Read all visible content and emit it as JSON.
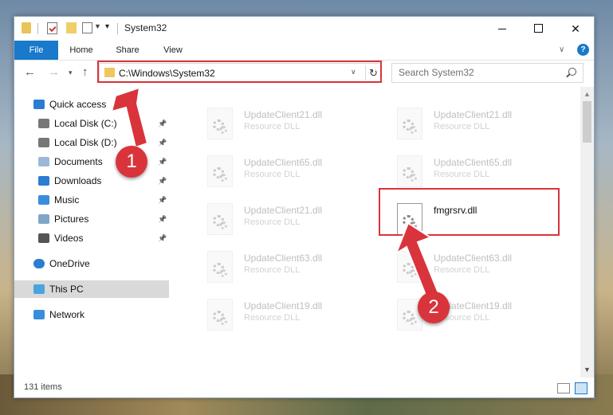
{
  "window": {
    "title": "System32",
    "quick_access_toolbar": [
      "folder-icon",
      "properties-icon",
      "new-folder-icon",
      "view-icon"
    ],
    "buttons": {
      "minimize": "—",
      "maximize": "☐",
      "close": "✕"
    }
  },
  "ribbon": {
    "tabs": [
      {
        "label": "File",
        "active": true
      },
      {
        "label": "Home"
      },
      {
        "label": "Share"
      },
      {
        "label": "View"
      }
    ],
    "help": "?"
  },
  "navigation": {
    "address": "C:\\Windows\\System32",
    "search_placeholder": "Search System32"
  },
  "nav_pane": {
    "items": [
      {
        "label": "Quick access",
        "icon": "star-icon",
        "pinned": false
      },
      {
        "label": "Local Disk (C:)",
        "icon": "drive-icon",
        "pinned": true
      },
      {
        "label": "Local Disk (D:)",
        "icon": "drive-icon",
        "pinned": true
      },
      {
        "label": "Documents",
        "icon": "documents-icon",
        "pinned": true
      },
      {
        "label": "Downloads",
        "icon": "downloads-icon",
        "pinned": true
      },
      {
        "label": "Music",
        "icon": "music-icon",
        "pinned": true
      },
      {
        "label": "Pictures",
        "icon": "pictures-icon",
        "pinned": true
      },
      {
        "label": "Videos",
        "icon": "videos-icon",
        "pinned": true
      },
      {
        "label": "OneDrive",
        "icon": "cloud-icon",
        "pinned": false
      },
      {
        "label": "This PC",
        "icon": "computer-icon",
        "pinned": false,
        "selected": true
      },
      {
        "label": "Network",
        "icon": "network-icon",
        "pinned": false
      }
    ]
  },
  "files": {
    "col1": [
      {
        "name": "UpdateClient21.dll",
        "type": "Resource DLL"
      },
      {
        "name": "UpdateClient65.dll",
        "type": "Resource DLL"
      },
      {
        "name": "UpdateClient21.dll",
        "type": "Resource DLL"
      },
      {
        "name": "UpdateClient63.dll",
        "type": "Resource DLL"
      },
      {
        "name": "UpdateClient19.dll",
        "type": "Resource DLL"
      }
    ],
    "col2": [
      {
        "name": "UpdateClient21.dll",
        "type": "Resource DLL"
      },
      {
        "name": "UpdateClient65.dll",
        "type": "Resource DLL"
      },
      {
        "name": "fmgrsrv.dll",
        "type": ""
      },
      {
        "name": "UpdateClient63.dll",
        "type": "Resource DLL"
      },
      {
        "name": "UpdateClient19.dll",
        "type": "Resource DLL"
      }
    ]
  },
  "status": {
    "items": "131 items"
  },
  "callouts": {
    "one": "1",
    "two": "2"
  },
  "colors": {
    "accent": "#1979ca",
    "highlight": "#d9343b"
  }
}
